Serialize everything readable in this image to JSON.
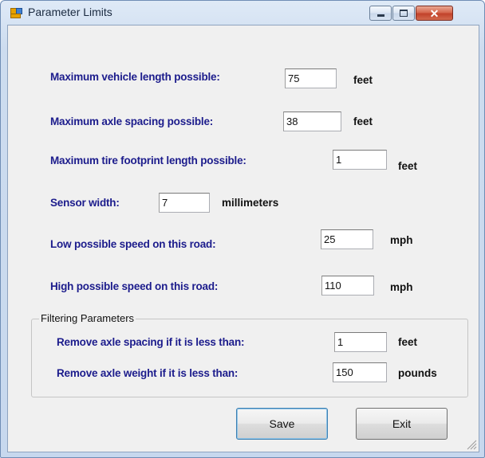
{
  "window": {
    "title": "Parameter Limits",
    "close_glyph": "✕"
  },
  "fields": [
    {
      "label": "Maximum vehicle length possible:",
      "value": "75",
      "unit": "feet"
    },
    {
      "label": "Maximum axle spacing possible:",
      "value": "38",
      "unit": "feet"
    },
    {
      "label": "Maximum tire footprint length possible:",
      "value": "1",
      "unit": "feet"
    },
    {
      "label": "Sensor width:",
      "value": "7",
      "unit": "millimeters"
    },
    {
      "label": "Low possible speed on this road:",
      "value": "25",
      "unit": "mph"
    },
    {
      "label": "High possible speed on this road:",
      "value": "110",
      "unit": "mph"
    }
  ],
  "filtering": {
    "caption": "Filtering Parameters",
    "fields": [
      {
        "label": "Remove axle spacing if it is less than:",
        "value": "1",
        "unit": "feet"
      },
      {
        "label": "Remove axle weight if it is less than:",
        "value": "150",
        "unit": "pounds"
      }
    ]
  },
  "buttons": {
    "save": "Save",
    "exit": "Exit"
  },
  "colors": {
    "label_text": "#1c1c8c",
    "close_button": "#c2422a"
  }
}
